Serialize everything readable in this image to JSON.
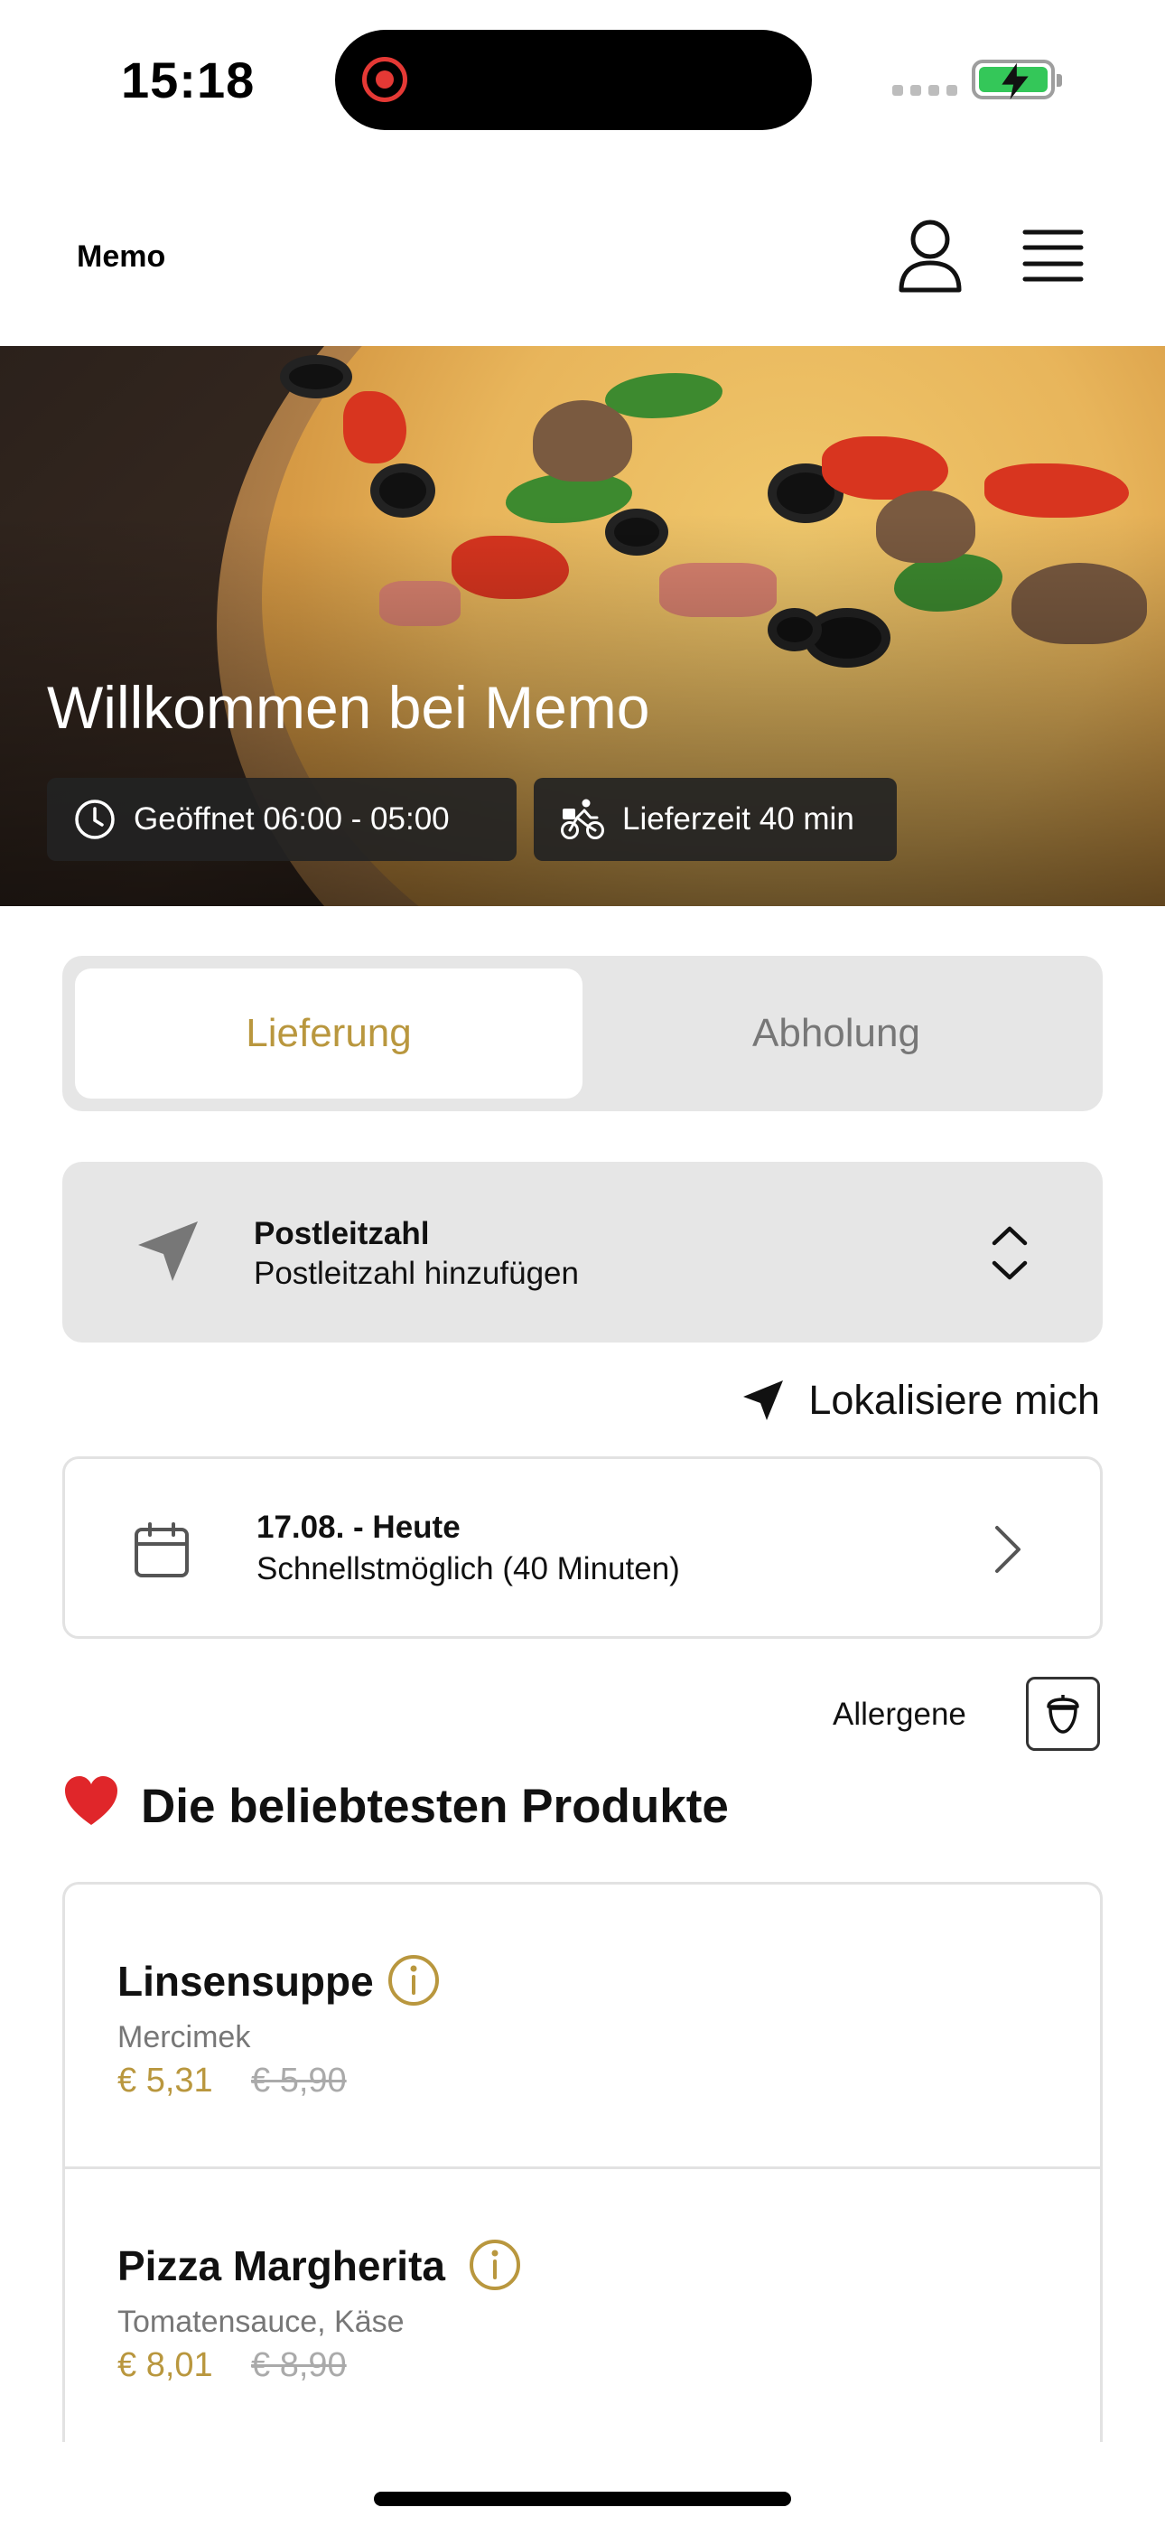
{
  "status_bar": {
    "time": "15:18"
  },
  "header": {
    "brand": "Memo"
  },
  "hero": {
    "title": "Willkommen bei Memo",
    "opening_hours": "Geöffnet 06:00 - 05:00",
    "delivery_time": "Lieferzeit 40 min"
  },
  "mode_tabs": [
    {
      "label": "Lieferung",
      "selected": true
    },
    {
      "label": "Abholung",
      "selected": false
    }
  ],
  "postal": {
    "label": "Postleitzahl",
    "placeholder": "Postleitzahl hinzufügen"
  },
  "locate": {
    "label": "Lokalisiere mich"
  },
  "date": {
    "label": "17.08. - Heute",
    "sub": "Schnellstmöglich (40 Minuten)"
  },
  "allergens": {
    "label": "Allergene"
  },
  "section": {
    "emoji": "❤️",
    "title": "Die beliebtesten Produkte"
  },
  "products": [
    {
      "name": "Linsensuppe",
      "description": "Mercimek",
      "price": "€ 5,31",
      "old_price": "€ 5,90"
    },
    {
      "name": "Pizza Margherita",
      "description": "Tomatensauce, Käse",
      "price": "€ 8,01",
      "old_price": "€ 8,90"
    }
  ],
  "colors": {
    "accent": "#b9973e",
    "tab_bg": "#e6e6e6",
    "chip_bg": "#232323"
  },
  "icons": [
    "recording-icon",
    "battery-charging-icon",
    "user-icon",
    "menu-icon",
    "clock-icon",
    "bicycle-icon",
    "navigation-arrow-icon",
    "chevron-up-down-icon",
    "calendar-icon",
    "chevron-right-icon",
    "acorn-icon",
    "info-icon",
    "heart-icon"
  ]
}
